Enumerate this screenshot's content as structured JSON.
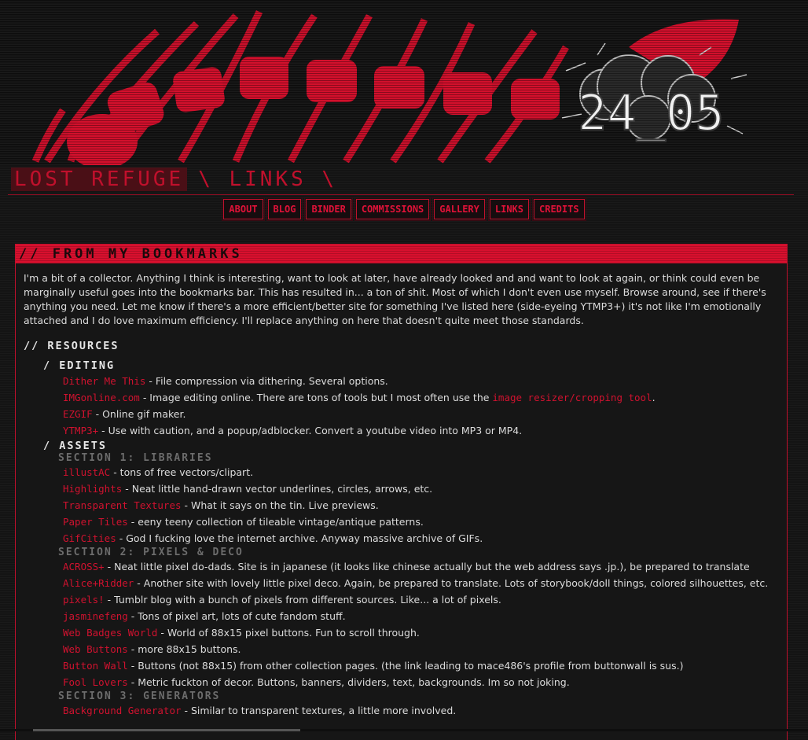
{
  "banner": {
    "date_text": "24_05"
  },
  "site": {
    "title": "LOST REFUGE",
    "title_rest": "\\ LINKS \\"
  },
  "nav": {
    "items": [
      "ABOUT",
      "BLOG",
      "BINDER",
      "COMMISSIONS",
      "GALLERY",
      "LINKS",
      "CREDITS"
    ]
  },
  "panel": {
    "header": "// FROM MY BOOKMARKS",
    "intro": "I'm a bit of a collector. Anything I think is interesting, want to look at later, have already looked and and want to look at again, or think could even be marginally useful goes into the bookmarks bar. This has resulted in... a ton of shit. Most of which I don't even use myself. Browse around, see if there's anything you need. Let me know if there's a more efficient/better site for something I've listed here (side-eyeing YTMP3+) it's not like I'm emotionally attached and I do love maximum efficiency. I'll replace anything on here that doesn't quite meet those standards."
  },
  "resources": {
    "heading": "// RESOURCES",
    "editing": {
      "heading": "/ EDITING",
      "entries": [
        {
          "link": "Dither Me This",
          "desc": " - File compression via dithering. Several options."
        },
        {
          "link": "IMGonline.com",
          "desc": " - Image editing online. There are tons of tools but I most often use the ",
          "link2": "image resizer/cropping tool",
          "desc2": "."
        },
        {
          "link": "EZGIF",
          "desc": " - Online gif maker."
        },
        {
          "link": "YTMP3+",
          "desc": " - Use with caution, and a popup/adblocker. Convert a youtube video into MP3 or MP4."
        }
      ]
    },
    "assets": {
      "heading": "/ ASSETS",
      "section1": {
        "heading": "SECTION 1: LIBRARIES",
        "entries": [
          {
            "link": "illustAC",
            "desc": " - tons of free vectors/clipart."
          },
          {
            "link": "Highlights",
            "desc": " - Neat little hand-drawn vector underlines, circles, arrows, etc."
          },
          {
            "link": "Transparent Textures",
            "desc": " - What it says on the tin. Live previews."
          },
          {
            "link": "Paper Tiles",
            "desc": " - eeny teeny collection of tileable vintage/antique patterns."
          },
          {
            "link": "GifCities",
            "desc": " - God I fucking love the internet archive. Anyway massive archive of GIFs."
          }
        ]
      },
      "section2": {
        "heading": "SECTION 2: PIXELS & DECO",
        "entries": [
          {
            "link": "ACROSS+",
            "desc": " - Neat little pixel do-dads. Site is in japanese (it looks like chinese actually but the web address says .jp.), be prepared to translate"
          },
          {
            "link": "Alice+Ridder",
            "desc": " - Another site with lovely little pixel deco. Again, be prepared to translate. Lots of storybook/doll things, colored silhouettes, etc."
          },
          {
            "link": "pixels!",
            "desc": " - Tumblr blog with a bunch of pixels from different sources. Like... a lot of pixels."
          },
          {
            "link": "jasminefeng",
            "desc": " - Tons of pixel art, lots of cute fandom stuff."
          },
          {
            "link": "Web Badges World",
            "desc": " - World of 88x15 pixel buttons. Fun to scroll through."
          },
          {
            "link": "Web Buttons",
            "desc": " - more 88x15 buttons."
          },
          {
            "link": "Button Wall",
            "desc": " - Buttons (not 88x15) from other collection pages. (the link leading to mace486's profile from buttonwall is sus.)"
          },
          {
            "link": "Fool Lovers",
            "desc": " - Metric fuckton of decor. Buttons, banners, dividers, text, backgrounds. Im so not joking."
          }
        ]
      },
      "section3": {
        "heading": "SECTION 3: GENERATORS",
        "entries": [
          {
            "link": "Background Generator",
            "desc": " - Similar to transparent textures, a little more involved."
          }
        ]
      }
    }
  }
}
